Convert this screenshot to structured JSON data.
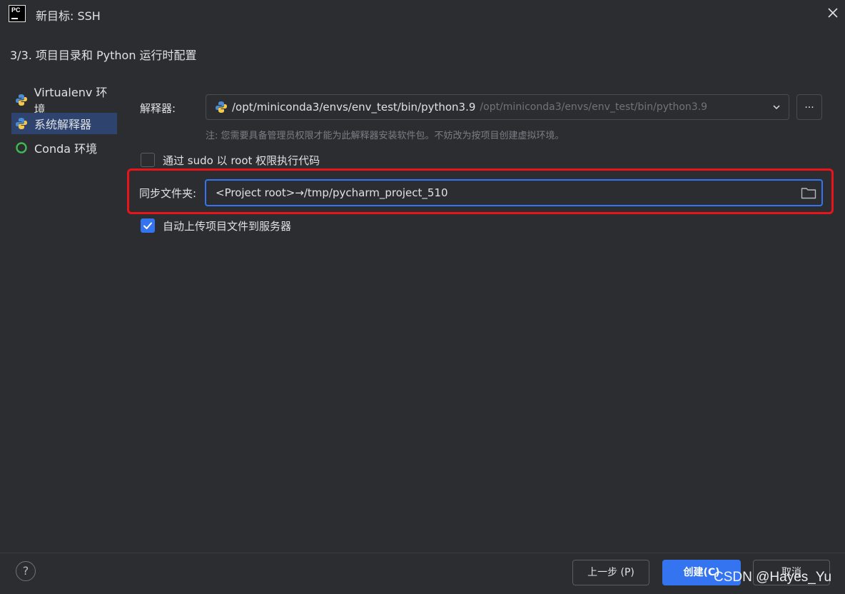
{
  "window": {
    "app_logo_text": "PC",
    "title": "新目标: SSH"
  },
  "step": {
    "title": "3/3. 项目目录和 Python 运行时配置"
  },
  "sidebar": {
    "items": [
      {
        "label": "Virtualenv 环境",
        "icon": "python-icon",
        "selected": false
      },
      {
        "label": "系统解释器",
        "icon": "python-icon",
        "selected": true
      },
      {
        "label": "Conda 环境",
        "icon": "conda-ring-icon",
        "selected": false
      }
    ]
  },
  "form": {
    "interpreter_label": "解释器:",
    "interpreter_value": "/opt/miniconda3/envs/env_test/bin/python3.9",
    "interpreter_value_dim": "/opt/miniconda3/envs/env_test/bin/python3.9",
    "more_label": "...",
    "note": "注: 您需要具备管理员权限才能为此解释器安装软件包。不妨改为按项目创建虚拟环境。",
    "sudo_label": "通过 sudo 以 root 权限执行代码",
    "sudo_checked": false,
    "sync_label": "同步文件夹:",
    "sync_value": "<Project root>→/tmp/pycharm_project_510",
    "upload_label": "自动上传项目文件到服务器",
    "upload_checked": true
  },
  "footer": {
    "help_label": "?",
    "prev_label": "上一步 (P)",
    "create_label": "创建(C)",
    "cancel_label": "取消"
  },
  "watermark": "CSDN @Hayes_Yu",
  "colors": {
    "background": "#2b2d30",
    "accent": "#3574f0",
    "highlight_box": "#e8141a",
    "selected_item": "#2e436e"
  }
}
